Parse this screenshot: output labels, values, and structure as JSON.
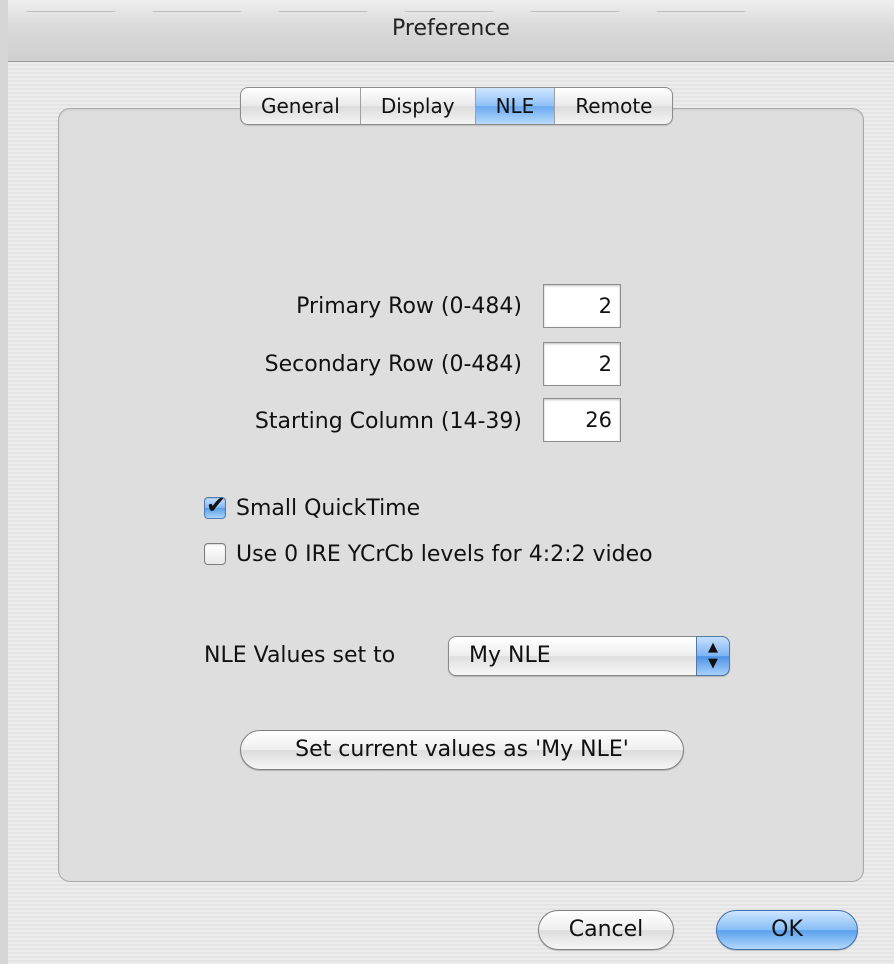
{
  "window": {
    "title": "Preference"
  },
  "tabs": [
    {
      "label": "General",
      "selected": false
    },
    {
      "label": "Display",
      "selected": false
    },
    {
      "label": "NLE",
      "selected": true
    },
    {
      "label": "Remote",
      "selected": false
    }
  ],
  "fields": {
    "primary_row": {
      "label": "Primary Row (0-484)",
      "value": "2"
    },
    "secondary_row": {
      "label": "Secondary Row (0-484)",
      "value": "2"
    },
    "starting_column": {
      "label": "Starting Column (14-39)",
      "value": "26"
    }
  },
  "checkboxes": {
    "small_quicktime": {
      "label": "Small QuickTime",
      "checked": true
    },
    "ire_levels": {
      "label": "Use 0 IRE YCrCb levels for 4:2:2 video",
      "checked": false
    }
  },
  "nle_values": {
    "label": "NLE Values set to",
    "selected": "My NLE"
  },
  "buttons": {
    "set_current": "Set current values as 'My NLE'",
    "cancel": "Cancel",
    "ok": "OK"
  },
  "colors": {
    "accent_blue": "#6aa9f0"
  }
}
